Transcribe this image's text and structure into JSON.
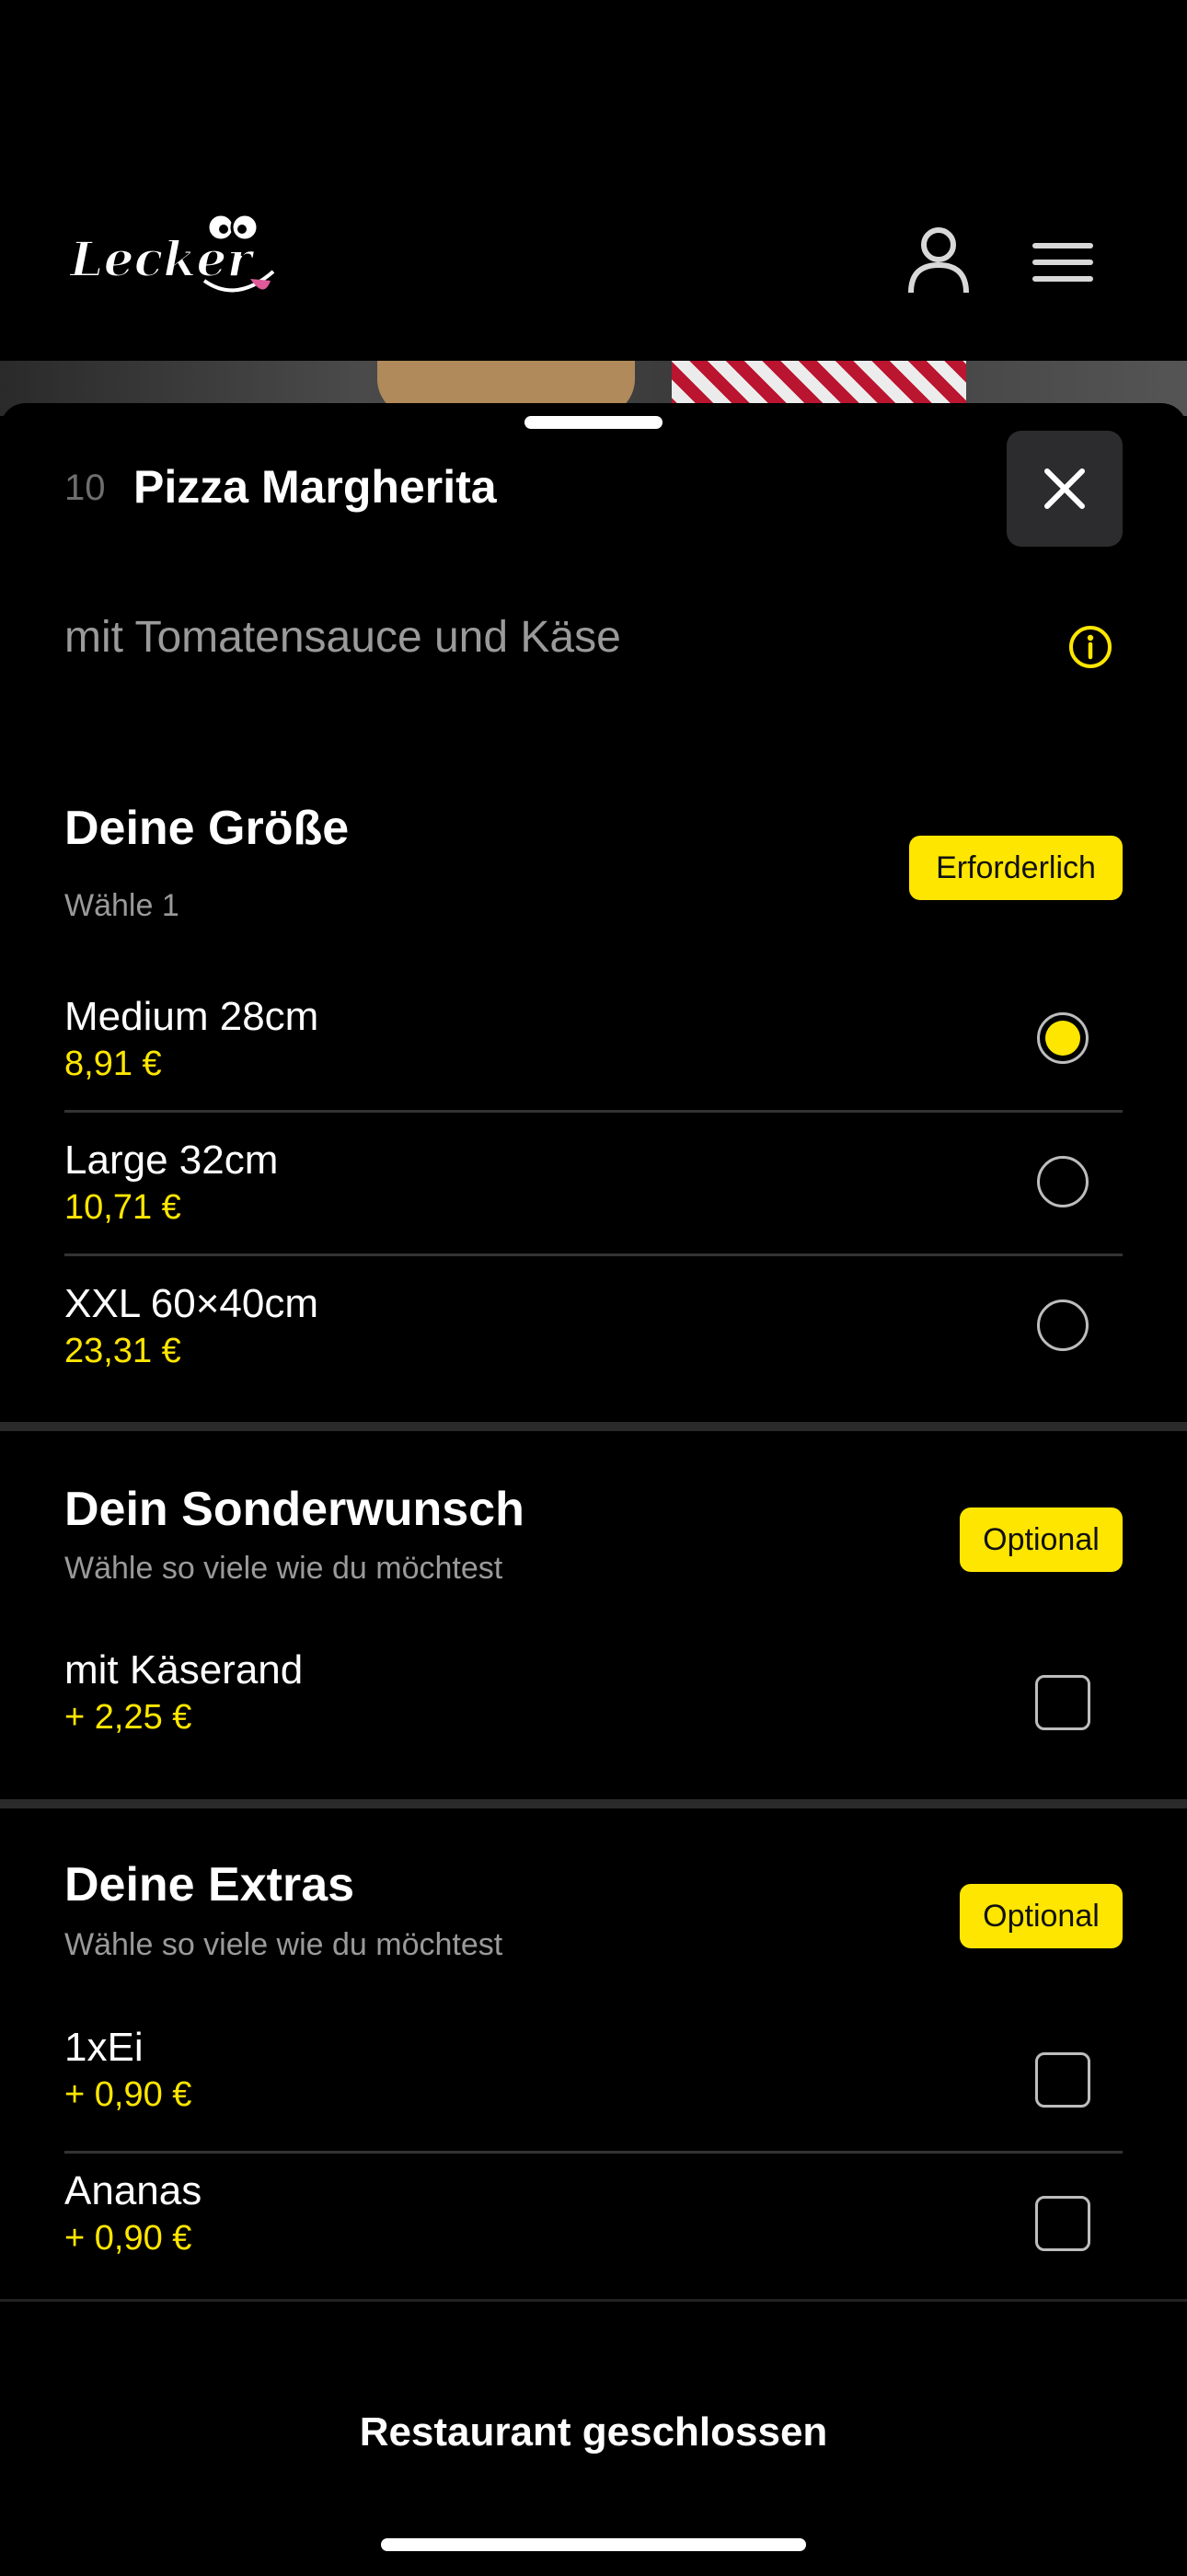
{
  "header": {
    "logo_text": "Lecker"
  },
  "item": {
    "number": "10",
    "name": "Pizza Margherita",
    "description": "mit Tomatensauce und Käse"
  },
  "groups": {
    "size": {
      "title": "Deine Größe",
      "subtitle": "Wähle 1",
      "badge": "Erforderlich",
      "options": [
        {
          "label": "Medium 28cm",
          "price": "8,91 €",
          "selected": true
        },
        {
          "label": "Large 32cm",
          "price": "10,71 €",
          "selected": false
        },
        {
          "label": "XXL 60×40cm",
          "price": "23,31 €",
          "selected": false
        }
      ]
    },
    "special": {
      "title": "Dein Sonderwunsch",
      "subtitle": "Wähle so viele wie du möchtest",
      "badge": "Optional",
      "options": [
        {
          "label": "mit Käserand",
          "price": "+ 2,25 €",
          "checked": false
        }
      ]
    },
    "extras": {
      "title": "Deine Extras",
      "subtitle": "Wähle so viele wie du möchtest",
      "badge": "Optional",
      "options": [
        {
          "label": "1xEi",
          "price": "+ 0,90 €",
          "checked": false
        },
        {
          "label": "Ananas",
          "price": "+ 0,90 €",
          "checked": false
        }
      ]
    }
  },
  "footer": {
    "status": "Restaurant geschlossen"
  },
  "colors": {
    "accent": "#ffe600",
    "background": "#000000"
  }
}
